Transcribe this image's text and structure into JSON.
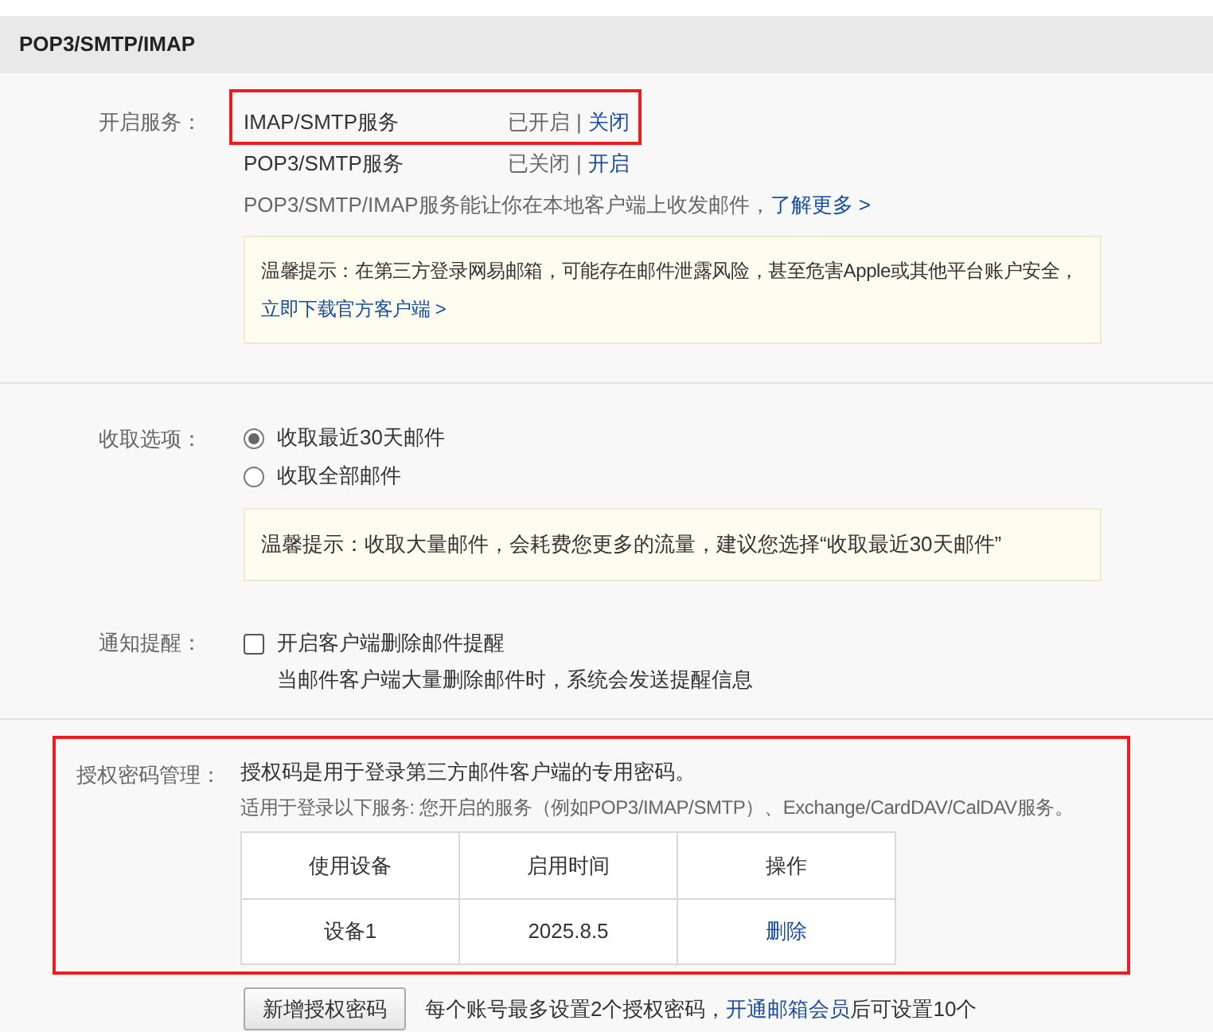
{
  "header": {
    "title": "POP3/SMTP/IMAP"
  },
  "services": {
    "label": "开启服务：",
    "items": [
      {
        "name": "IMAP/SMTP服务",
        "status": "已开启",
        "separator": "|",
        "action": "关闭",
        "highlighted": true
      },
      {
        "name": "POP3/SMTP服务",
        "status": "已关闭",
        "separator": "|",
        "action": "开启",
        "highlighted": false
      }
    ],
    "note": [
      {
        "kind": "text",
        "text": "POP3/SMTP/IMAP服务能让你在本地客户端上收发邮件，"
      },
      {
        "kind": "link",
        "text": "了解更多 >"
      }
    ],
    "tip": [
      {
        "kind": "text",
        "text": "温馨提示：在第三方登录网易邮箱，可能存在邮件泄露风险，甚至危害Apple或其他平台账户安全，"
      },
      {
        "kind": "link",
        "text": "立即下载官方客户端 >"
      }
    ]
  },
  "fetch": {
    "label": "收取选项：",
    "options": [
      {
        "label": "收取最近30天邮件",
        "selected": true
      },
      {
        "label": "收取全部邮件",
        "selected": false
      }
    ],
    "tip": [
      {
        "kind": "text",
        "text": "温馨提示：收取大量邮件，会耗费您更多的流量，建议您选择“收取最近30天邮件”"
      }
    ]
  },
  "notify": {
    "label": "通知提醒：",
    "checkbox": {
      "label": "开启客户端删除邮件提醒",
      "checked": false
    },
    "description": "当邮件客户端大量删除邮件时，系统会发送提醒信息"
  },
  "auth": {
    "label": "授权密码管理：",
    "highlighted": true,
    "intro": "授权码是用于登录第三方邮件客户端的专用密码。",
    "services_note": "适用于登录以下服务: 您开启的服务（例如POP3/IMAP/SMTP）、Exchange/CardDAV/CalDAV服务。",
    "table": {
      "columns": [
        "使用设备",
        "启用时间",
        "操作"
      ],
      "rows": [
        [
          {
            "kind": "text",
            "text": "设备1"
          },
          {
            "kind": "text",
            "text": "2025.8.5"
          },
          {
            "kind": "link",
            "text": "删除"
          }
        ]
      ]
    },
    "add_button": "新增授权密码",
    "limit_note": [
      {
        "kind": "text",
        "text": "每个账号最多设置2个授权密码，"
      },
      {
        "kind": "link",
        "text": "开通邮箱会员"
      },
      {
        "kind": "text",
        "text": "后可设置10个"
      }
    ]
  }
}
